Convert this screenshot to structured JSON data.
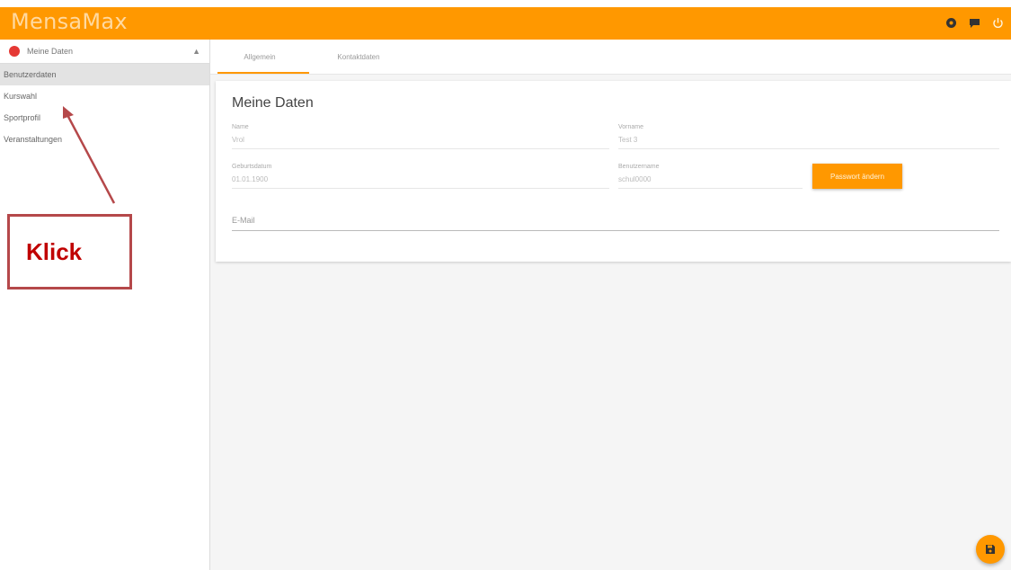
{
  "app": {
    "title": "MensaMax"
  },
  "topbar": {
    "icons": [
      "settings-icon",
      "chat-icon",
      "power-icon"
    ],
    "accent": "#ff9800"
  },
  "sidebar": {
    "header": "Meine Daten",
    "items": [
      {
        "label": "Benutzerdaten",
        "active": true
      },
      {
        "label": "Kurswahl"
      },
      {
        "label": "Sportprofil"
      },
      {
        "label": "Veranstaltungen"
      }
    ]
  },
  "tabs": [
    "Allgemein",
    "Kontaktdaten"
  ],
  "card": {
    "title": "Meine Daten",
    "fields": {
      "name": {
        "label": "Name",
        "value": "Vrol"
      },
      "vorname": {
        "label": "Vorname",
        "value": "Test 3"
      },
      "geburtsdatum": {
        "label": "Geburtsdatum",
        "value": "01.01.1900"
      },
      "benutzername": {
        "label": "Benutzername",
        "value": "schul0000"
      }
    },
    "password_button": "Passwort ändern",
    "email_label": "E-Mail"
  },
  "callout": {
    "text": "Klick",
    "color": "#c00000"
  },
  "fab": {
    "icon": "save-icon"
  }
}
